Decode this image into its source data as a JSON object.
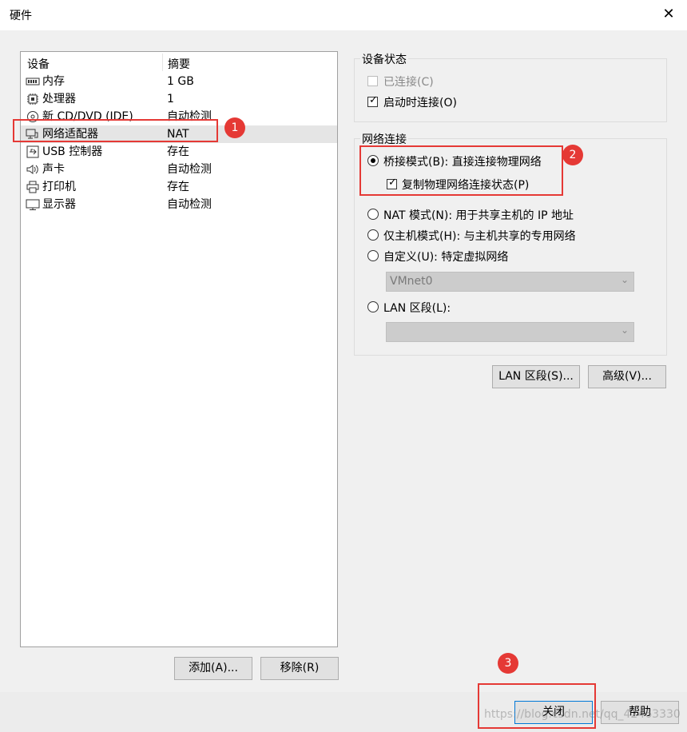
{
  "window": {
    "title": "硬件",
    "close_glyph": "✕"
  },
  "device_list": {
    "header_device": "设备",
    "header_summary": "摘要",
    "rows": [
      {
        "icon": "memory-icon",
        "name": "内存",
        "summary": "1 GB",
        "selected": false
      },
      {
        "icon": "processor-icon",
        "name": "处理器",
        "summary": "1",
        "selected": false
      },
      {
        "icon": "cd-dvd-icon",
        "name": "新 CD/DVD (IDE)",
        "summary": "自动检测",
        "selected": false
      },
      {
        "icon": "network-adapter-icon",
        "name": "网络适配器",
        "summary": "NAT",
        "selected": true
      },
      {
        "icon": "usb-icon",
        "name": "USB 控制器",
        "summary": "存在",
        "selected": false
      },
      {
        "icon": "speaker-icon",
        "name": "声卡",
        "summary": "自动检测",
        "selected": false
      },
      {
        "icon": "printer-icon",
        "name": "打印机",
        "summary": "存在",
        "selected": false
      },
      {
        "icon": "monitor-icon",
        "name": "显示器",
        "summary": "自动检测",
        "selected": false
      }
    ],
    "add_button": "添加(A)...",
    "remove_button": "移除(R)"
  },
  "device_status": {
    "legend": "设备状态",
    "connected_label": "已连接(C)",
    "connected_checked": false,
    "connected_disabled": true,
    "connect_at_power_on_label": "启动时连接(O)",
    "connect_at_power_on_checked": true
  },
  "network_connection": {
    "legend": "网络连接",
    "bridged_label": "桥接模式(B): 直接连接物理网络",
    "replicate_label": "复制物理网络连接状态(P)",
    "replicate_checked": true,
    "nat_label": "NAT 模式(N): 用于共享主机的 IP 地址",
    "host_only_label": "仅主机模式(H): 与主机共享的专用网络",
    "custom_label": "自定义(U): 特定虚拟网络",
    "custom_select_value": "VMnet0",
    "lan_segment_label": "LAN 区段(L):",
    "lan_segment_select_value": "",
    "selected_mode": "bridged"
  },
  "buttons": {
    "lan_segments": "LAN 区段(S)...",
    "advanced": "高级(V)...",
    "close": "关闭",
    "help": "帮助"
  },
  "annotations": {
    "marker_1": "1",
    "marker_2": "2",
    "marker_3": "3",
    "highlight_color": "#e53935"
  },
  "watermark": "https://blog.csdn.net/qq_42463330"
}
